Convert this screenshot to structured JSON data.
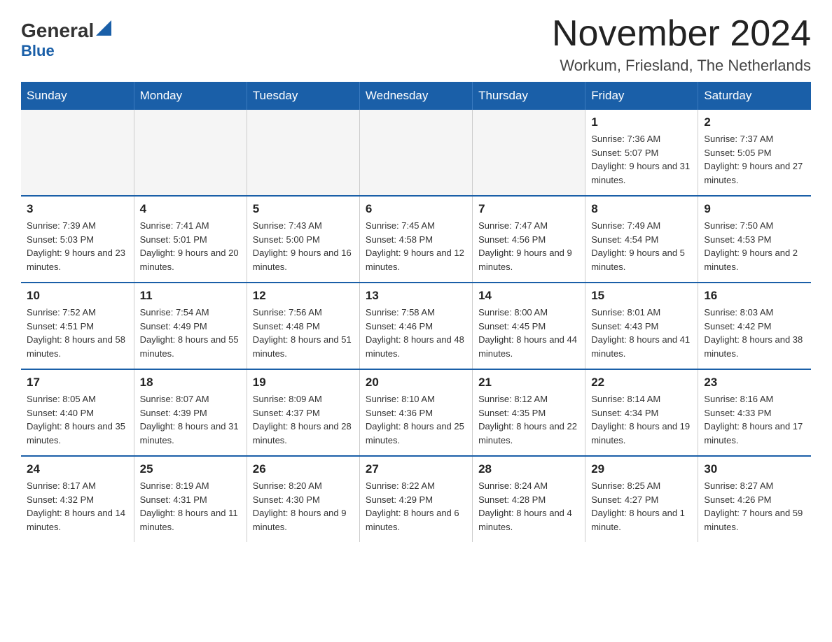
{
  "header": {
    "logo_general": "General",
    "logo_blue": "Blue",
    "title": "November 2024",
    "subtitle": "Workum, Friesland, The Netherlands"
  },
  "days_of_week": [
    "Sunday",
    "Monday",
    "Tuesday",
    "Wednesday",
    "Thursday",
    "Friday",
    "Saturday"
  ],
  "weeks": [
    [
      {
        "day": "",
        "info": ""
      },
      {
        "day": "",
        "info": ""
      },
      {
        "day": "",
        "info": ""
      },
      {
        "day": "",
        "info": ""
      },
      {
        "day": "",
        "info": ""
      },
      {
        "day": "1",
        "info": "Sunrise: 7:36 AM\nSunset: 5:07 PM\nDaylight: 9 hours and 31 minutes."
      },
      {
        "day": "2",
        "info": "Sunrise: 7:37 AM\nSunset: 5:05 PM\nDaylight: 9 hours and 27 minutes."
      }
    ],
    [
      {
        "day": "3",
        "info": "Sunrise: 7:39 AM\nSunset: 5:03 PM\nDaylight: 9 hours and 23 minutes."
      },
      {
        "day": "4",
        "info": "Sunrise: 7:41 AM\nSunset: 5:01 PM\nDaylight: 9 hours and 20 minutes."
      },
      {
        "day": "5",
        "info": "Sunrise: 7:43 AM\nSunset: 5:00 PM\nDaylight: 9 hours and 16 minutes."
      },
      {
        "day": "6",
        "info": "Sunrise: 7:45 AM\nSunset: 4:58 PM\nDaylight: 9 hours and 12 minutes."
      },
      {
        "day": "7",
        "info": "Sunrise: 7:47 AM\nSunset: 4:56 PM\nDaylight: 9 hours and 9 minutes."
      },
      {
        "day": "8",
        "info": "Sunrise: 7:49 AM\nSunset: 4:54 PM\nDaylight: 9 hours and 5 minutes."
      },
      {
        "day": "9",
        "info": "Sunrise: 7:50 AM\nSunset: 4:53 PM\nDaylight: 9 hours and 2 minutes."
      }
    ],
    [
      {
        "day": "10",
        "info": "Sunrise: 7:52 AM\nSunset: 4:51 PM\nDaylight: 8 hours and 58 minutes."
      },
      {
        "day": "11",
        "info": "Sunrise: 7:54 AM\nSunset: 4:49 PM\nDaylight: 8 hours and 55 minutes."
      },
      {
        "day": "12",
        "info": "Sunrise: 7:56 AM\nSunset: 4:48 PM\nDaylight: 8 hours and 51 minutes."
      },
      {
        "day": "13",
        "info": "Sunrise: 7:58 AM\nSunset: 4:46 PM\nDaylight: 8 hours and 48 minutes."
      },
      {
        "day": "14",
        "info": "Sunrise: 8:00 AM\nSunset: 4:45 PM\nDaylight: 8 hours and 44 minutes."
      },
      {
        "day": "15",
        "info": "Sunrise: 8:01 AM\nSunset: 4:43 PM\nDaylight: 8 hours and 41 minutes."
      },
      {
        "day": "16",
        "info": "Sunrise: 8:03 AM\nSunset: 4:42 PM\nDaylight: 8 hours and 38 minutes."
      }
    ],
    [
      {
        "day": "17",
        "info": "Sunrise: 8:05 AM\nSunset: 4:40 PM\nDaylight: 8 hours and 35 minutes."
      },
      {
        "day": "18",
        "info": "Sunrise: 8:07 AM\nSunset: 4:39 PM\nDaylight: 8 hours and 31 minutes."
      },
      {
        "day": "19",
        "info": "Sunrise: 8:09 AM\nSunset: 4:37 PM\nDaylight: 8 hours and 28 minutes."
      },
      {
        "day": "20",
        "info": "Sunrise: 8:10 AM\nSunset: 4:36 PM\nDaylight: 8 hours and 25 minutes."
      },
      {
        "day": "21",
        "info": "Sunrise: 8:12 AM\nSunset: 4:35 PM\nDaylight: 8 hours and 22 minutes."
      },
      {
        "day": "22",
        "info": "Sunrise: 8:14 AM\nSunset: 4:34 PM\nDaylight: 8 hours and 19 minutes."
      },
      {
        "day": "23",
        "info": "Sunrise: 8:16 AM\nSunset: 4:33 PM\nDaylight: 8 hours and 17 minutes."
      }
    ],
    [
      {
        "day": "24",
        "info": "Sunrise: 8:17 AM\nSunset: 4:32 PM\nDaylight: 8 hours and 14 minutes."
      },
      {
        "day": "25",
        "info": "Sunrise: 8:19 AM\nSunset: 4:31 PM\nDaylight: 8 hours and 11 minutes."
      },
      {
        "day": "26",
        "info": "Sunrise: 8:20 AM\nSunset: 4:30 PM\nDaylight: 8 hours and 9 minutes."
      },
      {
        "day": "27",
        "info": "Sunrise: 8:22 AM\nSunset: 4:29 PM\nDaylight: 8 hours and 6 minutes."
      },
      {
        "day": "28",
        "info": "Sunrise: 8:24 AM\nSunset: 4:28 PM\nDaylight: 8 hours and 4 minutes."
      },
      {
        "day": "29",
        "info": "Sunrise: 8:25 AM\nSunset: 4:27 PM\nDaylight: 8 hours and 1 minute."
      },
      {
        "day": "30",
        "info": "Sunrise: 8:27 AM\nSunset: 4:26 PM\nDaylight: 7 hours and 59 minutes."
      }
    ]
  ]
}
